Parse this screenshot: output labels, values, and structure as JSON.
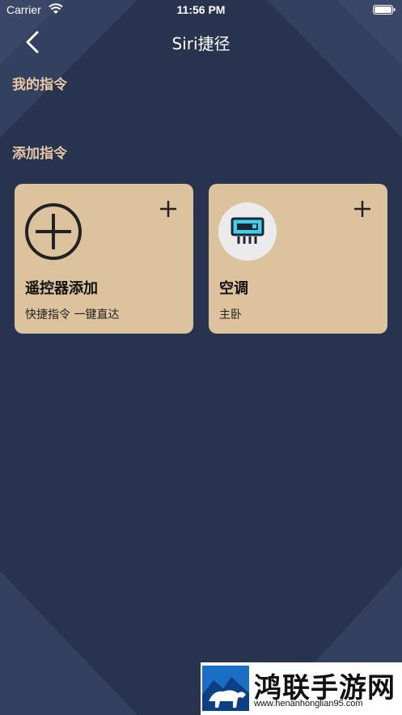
{
  "status_bar": {
    "carrier": "Carrier",
    "time": "11:56 PM"
  },
  "nav": {
    "title": "Siri捷径"
  },
  "sections": {
    "my_commands": "我的指令",
    "add_commands": "添加指令"
  },
  "cards": [
    {
      "title": "遥控器添加",
      "subtitle": "快捷指令 一键直达",
      "icon": "add-circle-icon"
    },
    {
      "title": "空调",
      "subtitle": "主卧",
      "icon": "air-conditioner-icon"
    }
  ],
  "watermark": {
    "name": "鸿联手游网",
    "url": "www.henanhonglian95.com"
  },
  "colors": {
    "background": "#283350",
    "card": "#dcc39e",
    "section_title": "#e9c9a4",
    "ac_icon": "#3fd0e8"
  }
}
